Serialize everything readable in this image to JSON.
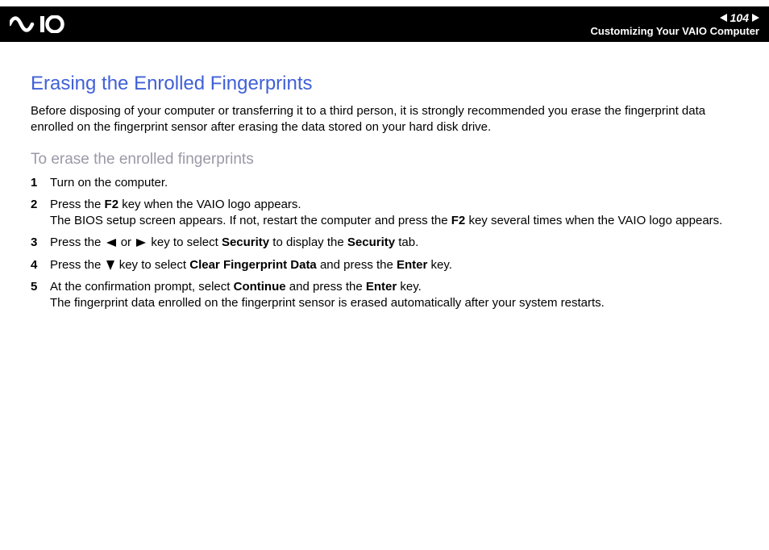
{
  "header": {
    "page_number": "104",
    "breadcrumb": "Customizing Your VAIO Computer"
  },
  "main": {
    "heading": "Erasing the Enrolled Fingerprints",
    "intro": "Before disposing of your computer or transferring it to a third person, it is strongly recommended you erase the fingerprint data enrolled on the fingerprint sensor after erasing the data stored on your hard disk drive.",
    "sub_heading": "To erase the enrolled fingerprints",
    "steps": [
      {
        "num": "1",
        "text_before": "Turn on the computer."
      },
      {
        "num": "2",
        "line1_pre": "Press the ",
        "line1_b1": "F2",
        "line1_post": " key when the VAIO logo appears.",
        "line2_pre": "The BIOS setup screen appears. If not, restart the computer and press the ",
        "line2_b1": "F2",
        "line2_post": " key several times when the VAIO logo appears."
      },
      {
        "num": "3",
        "s3_pre": "Press the ",
        "s3_mid": " or ",
        "s3_post1": " key to select ",
        "s3_b1": "Security",
        "s3_post2": " to display the ",
        "s3_b2": "Security",
        "s3_post3": " tab."
      },
      {
        "num": "4",
        "s4_pre": "Press the ",
        "s4_post1": " key to select ",
        "s4_b1": "Clear Fingerprint Data",
        "s4_post2": " and press the ",
        "s4_b2": "Enter",
        "s4_post3": " key."
      },
      {
        "num": "5",
        "s5_l1_pre": "At the confirmation prompt, select ",
        "s5_l1_b1": "Continue",
        "s5_l1_mid": " and press the ",
        "s5_l1_b2": "Enter",
        "s5_l1_post": " key.",
        "s5_l2": "The fingerprint data enrolled on the fingerprint sensor is erased automatically after your system restarts."
      }
    ]
  }
}
